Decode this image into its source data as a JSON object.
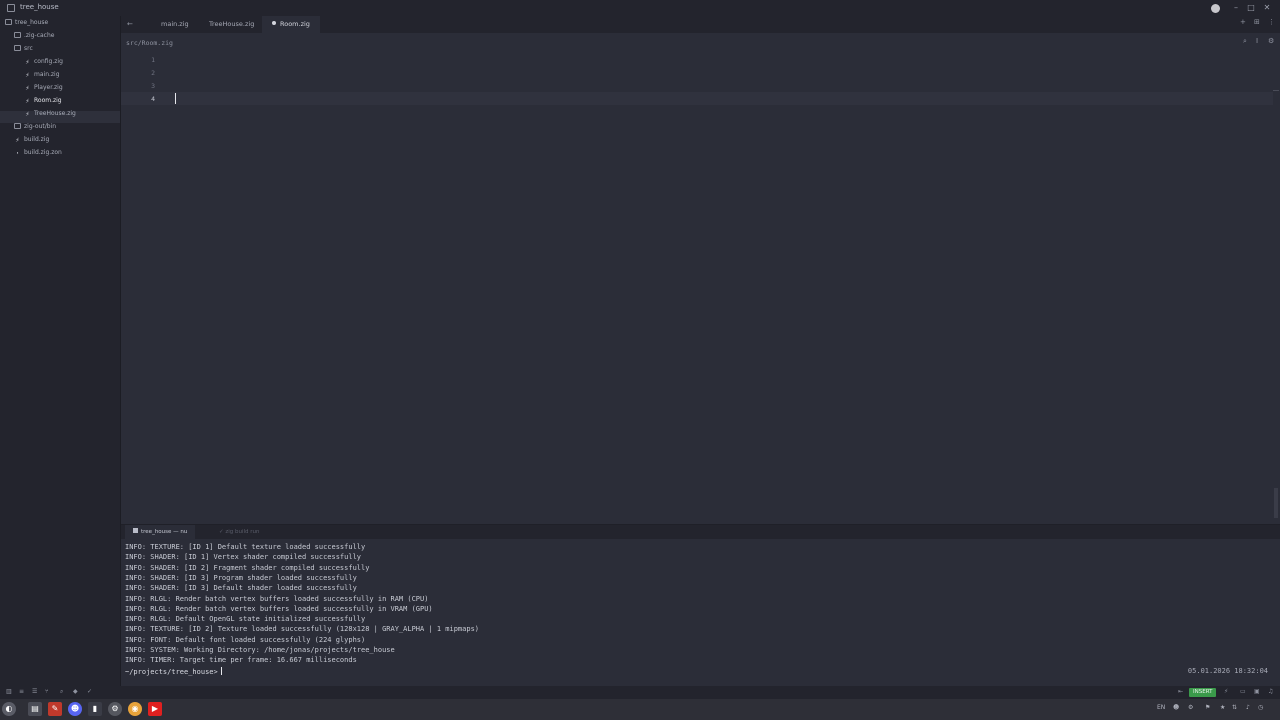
{
  "window": {
    "title": "tree_house"
  },
  "sidebar": {
    "items": [
      {
        "label": "tree_house",
        "icon": "folder-icon"
      },
      {
        "label": ".zig-cache",
        "icon": "folder-icon"
      },
      {
        "label": "src",
        "icon": "folder-icon"
      },
      {
        "label": "config.zig",
        "icon": "zig-file-icon"
      },
      {
        "label": "main.zig",
        "icon": "zig-file-icon"
      },
      {
        "label": "Player.zig",
        "icon": "zig-file-icon"
      },
      {
        "label": "Room.zig",
        "icon": "zig-file-icon"
      },
      {
        "label": "TreeHouse.zig",
        "icon": "zig-file-icon"
      },
      {
        "label": "zig-out/bin",
        "icon": "folder-icon"
      },
      {
        "label": "build.zig",
        "icon": "zig-file-icon"
      },
      {
        "label": "build.zig.zon",
        "icon": "file-icon"
      }
    ]
  },
  "tabs": [
    {
      "label": "main.zig"
    },
    {
      "label": "TreeHouse.zig"
    },
    {
      "label": "Room.zig"
    }
  ],
  "breadcrumb": "src/Room.zig",
  "editor": {
    "line_numbers": [
      "1",
      "2",
      "3",
      "4"
    ]
  },
  "terminal": {
    "tabs": [
      {
        "label": "tree_house — nu"
      },
      {
        "label": "zig build run"
      }
    ],
    "lines": [
      "INFO: TEXTURE: [ID 1] Default texture loaded successfully",
      "INFO: SHADER: [ID 1] Vertex shader compiled successfully",
      "INFO: SHADER: [ID 2] Fragment shader compiled successfully",
      "INFO: SHADER: [ID 3] Program shader loaded successfully",
      "INFO: SHADER: [ID 3] Default shader loaded successfully",
      "INFO: RLGL: Render batch vertex buffers loaded successfully in RAM (CPU)",
      "INFO: RLGL: Render batch vertex buffers loaded successfully in VRAM (GPU)",
      "INFO: RLGL: Default OpenGL state initialized successfully",
      "INFO: TEXTURE: [ID 2] Texture loaded successfully (128x128 | GRAY_ALPHA | 1 mipmaps)",
      "INFO: FONT: Default font loaded successfully (224 glyphs)",
      "INFO: SYSTEM: Working Directory: /home/jonas/projects/tree_house",
      "INFO: TIMER: Target time per frame: 16.667 milliseconds"
    ],
    "prompt": "~/projects/tree_house>",
    "datetime": "05.01.2026 18:32:04"
  },
  "statusbar": {
    "mode": "INSERT"
  },
  "taskbar": {
    "keyboard_layout": "EN"
  },
  "colors": {
    "accent_green": "#3a9a4a",
    "background": "#2b2d38",
    "panel": "#23242d"
  }
}
